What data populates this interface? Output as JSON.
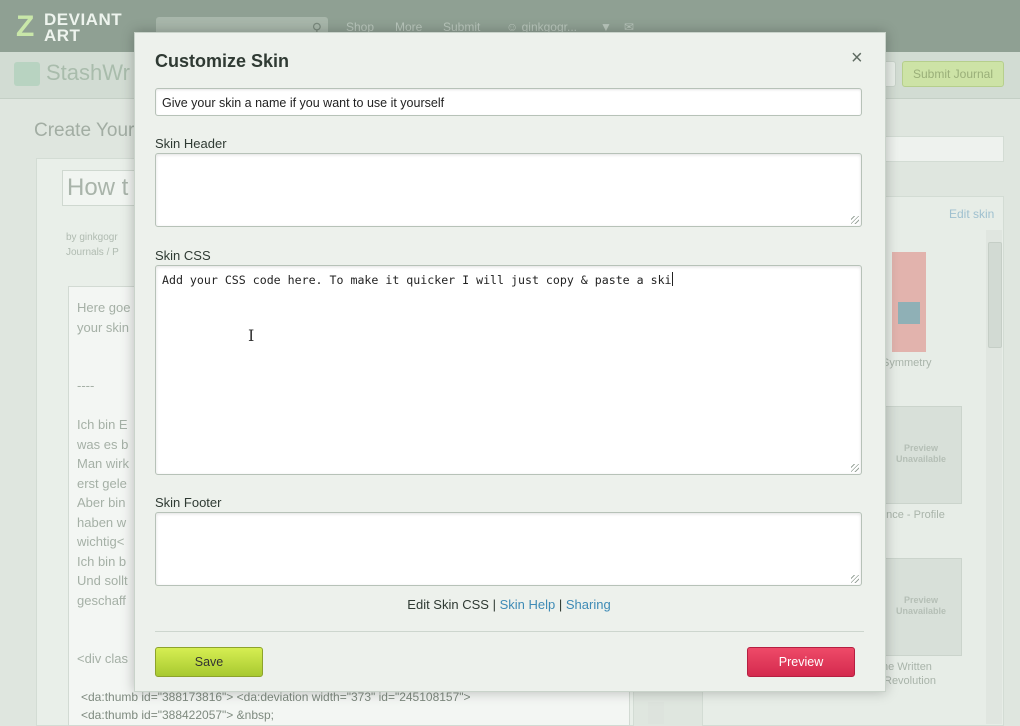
{
  "background": {
    "logo": {
      "line1": "DEVIANT",
      "line2": "ART"
    },
    "nav": {
      "shop": "Shop",
      "more": "More",
      "submit": "Submit",
      "user": "ginkgogr..."
    },
    "stash_title": "StashWr",
    "submit_journal": "Submit Journal",
    "create_heading": "Create Your J",
    "title_field": "How t",
    "byline": {
      "line1": "by ginkgogr",
      "line2": "Journals / P"
    },
    "body_lines": [
      "Here goe",
      "your skin",
      "",
      "",
      "----",
      "",
      "Ich bin E",
      "was es b",
      "Man wirk",
      "erst gele",
      "Aber bin",
      "haben w",
      "wichtig<",
      "Ich bin b",
      "Und sollt",
      "geschaff",
      "",
      "",
      "<div clas"
    ],
    "code_lines": [
      "<da:thumb id=\"388173816\"> <da:deviation width=\"373\" id=\"245108157\">",
      "<da:thumb id=\"388422057\"> &nbsp;"
    ],
    "edit_skin": "Edit skin",
    "skin_names": [
      "Symmetry",
      "ence - Profile",
      "he Written",
      "Revolution"
    ],
    "preview_unavailable": [
      "Preview\nUnavailable",
      "Preview\nUnavailable"
    ]
  },
  "modal": {
    "title": "Customize Skin",
    "close": "×",
    "name_field": {
      "value": "Give your skin a name if you want to use it yourself"
    },
    "header_label": "Skin Header",
    "header_value": "",
    "css_label": "Skin CSS",
    "css_value": "Add your CSS code here. To make it quicker I will just copy & paste a ski",
    "footer_label": "Skin Footer",
    "footer_value": "",
    "links": {
      "edit": "Edit Skin CSS",
      "sep": "|",
      "help": "Skin Help",
      "sharing": "Sharing"
    },
    "save": "Save",
    "preview": "Preview"
  },
  "colors": {
    "save": "#b9d83c",
    "preview": "#e23a5c",
    "link": "#3e8bb6"
  }
}
